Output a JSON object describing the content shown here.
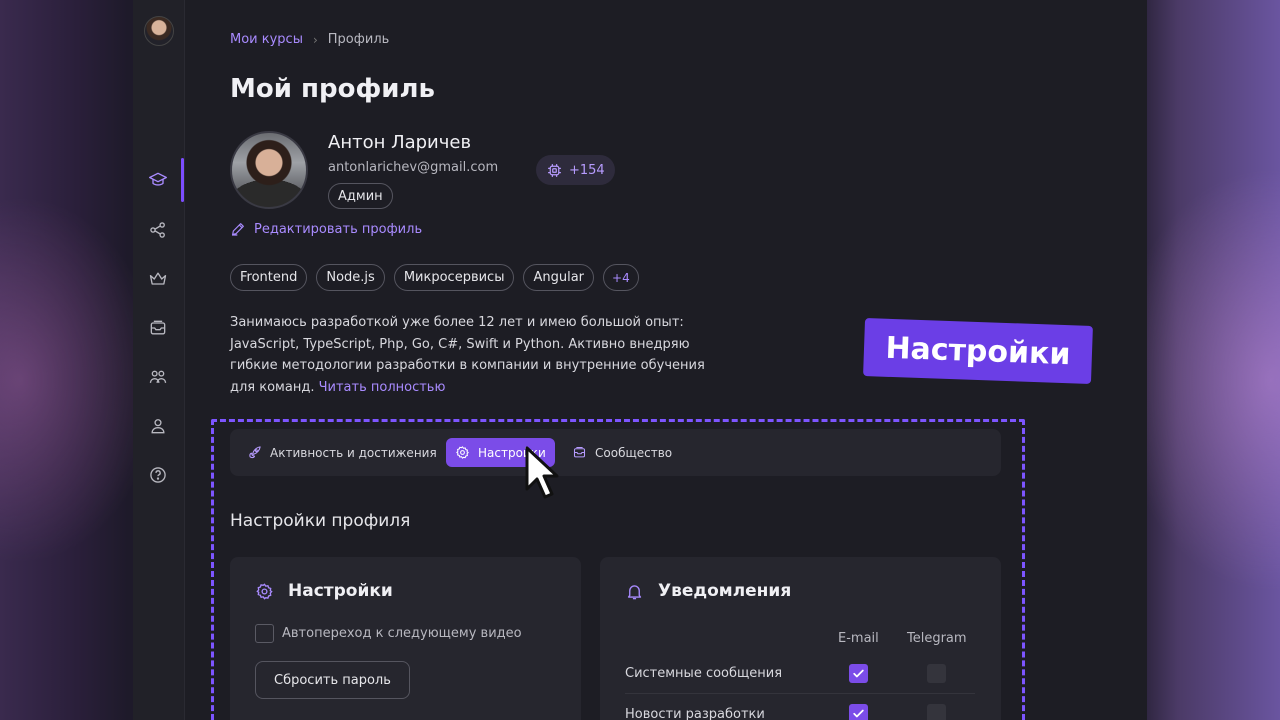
{
  "breadcrumb": {
    "parent": "Мои курсы",
    "current": "Профиль",
    "separator": "›"
  },
  "page_title": "Мой профиль",
  "profile": {
    "name": "Антон Ларичев",
    "email": "antonlarichev@gmail.com",
    "role": "Админ",
    "points": "+154",
    "edit_label": "Редактировать профиль",
    "tags": [
      "Frontend",
      "Node.js",
      "Микросервисы",
      "Angular"
    ],
    "tags_more": "+4",
    "bio_lines": [
      "Занимаюсь разработкой уже более 12 лет и имею большой опыт:",
      "JavaScript, TypeScript, Php, Go, C#, Swift и Python. Активно внедряю",
      "гибкие методологии разработки в компании и внутренние обучения",
      "для команд."
    ],
    "bio_more": "Читать полностью"
  },
  "overlay_badge": "Настройки",
  "tabs": [
    {
      "label": "Активность и достижения",
      "icon": "rocket-icon",
      "active": false
    },
    {
      "label": "Настройки",
      "icon": "gear-icon",
      "active": true
    },
    {
      "label": "Сообщество",
      "icon": "community-icon",
      "active": false
    }
  ],
  "section_title": "Настройки профиля",
  "settings_card": {
    "title": "Настройки",
    "icon": "gear-icon",
    "autoplay_label": "Автопереход к следующему видео",
    "autoplay_checked": false,
    "reset_button": "Сбросить пароль"
  },
  "notifications_card": {
    "title": "Уведомления",
    "icon": "bell-icon",
    "columns": [
      "E-mail",
      "Telegram"
    ],
    "rows": [
      {
        "label": "Системные сообщения",
        "email": true,
        "telegram": false
      },
      {
        "label": "Новости разработки",
        "email": true,
        "telegram": false
      }
    ]
  },
  "sidebar": {
    "items": [
      {
        "icon": "graduation-cap-icon",
        "active": true
      },
      {
        "icon": "share-nodes-icon",
        "active": false
      },
      {
        "icon": "crown-icon",
        "active": false
      },
      {
        "icon": "inbox-icon",
        "active": false
      },
      {
        "icon": "users-icon",
        "active": false
      },
      {
        "icon": "user-icon",
        "active": false
      },
      {
        "icon": "help-icon",
        "active": false
      }
    ]
  },
  "colors": {
    "accent": "#7b4ce8",
    "link": "#a98bff",
    "background": "#1d1d24",
    "card": "#26262e"
  }
}
